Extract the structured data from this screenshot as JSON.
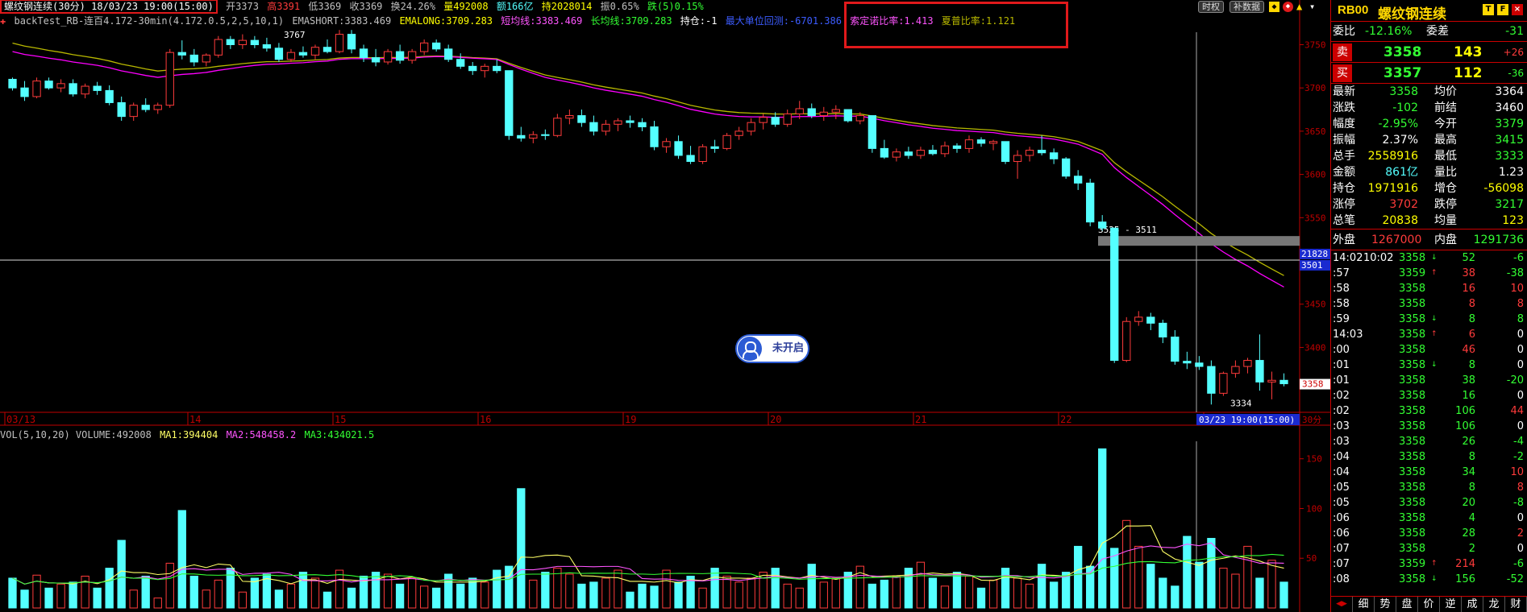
{
  "header": {
    "title": "螺纹钢连续(30分) 18/03/23 19:00(15:00)",
    "open": "开3373",
    "high": "高3391",
    "low": "低3369",
    "close": "收3369",
    "turnover": "换24.26%",
    "volume": "量492008",
    "amount": "额166亿",
    "oi": "持2028014",
    "amp": "振0.65%",
    "chg": "跌(5)0.15%",
    "btn_time": "时权",
    "btn_supp": "补数据"
  },
  "indicator": {
    "name": "backTest_RB-连百4.172-30min(4.172.0.5,2,5,10,1)",
    "emashort": "EMASHORT:3383.469",
    "emalong": "EMALONG:3709.283",
    "short_ma": "短均线:3383.469",
    "long_ma": "长均线:3709.283",
    "position": "持仓:-1",
    "max_dd": "最大单位回测:-6701.386",
    "calmar": "索定诺比率:1.413",
    "sharpe": "夏普比率:1.121"
  },
  "vol_header": {
    "name": "VOL(5,10,20) VOLUME:492008",
    "ma1": "MA1:394404",
    "ma2": "MA2:548458.2",
    "ma3": "MA3:434021.5"
  },
  "overlay": {
    "label_3767": "3767",
    "label_range": "3525 - 3511",
    "label_3334": "3334",
    "price_tag_top": "21828",
    "price_tag_bottom": "3501",
    "price_tag_last": "3358",
    "x_date": "03/23 19:00(15:00)",
    "period": "30分",
    "badge": "未开启"
  },
  "x_labels": [
    "03/13",
    "14",
    "15",
    "16",
    "19",
    "20",
    "21",
    "22",
    "23"
  ],
  "y_labels": [
    "3750",
    "3700",
    "3650",
    "3600",
    "3550",
    "3450",
    "3400"
  ],
  "vol_y_labels": [
    "150",
    "100",
    "50"
  ],
  "colors": {
    "up": "#ff3b3b",
    "down": "#54ffff",
    "ema_short": "#ff00ff",
    "ema_long": "#b8b800",
    "ma1": "#ffff66",
    "ma2": "#ff55ff",
    "ma3": "#33ff33",
    "axis": "#c00000"
  },
  "chart_data": {
    "type": "candlestick",
    "title": "螺纹钢连续(30分)",
    "ylim": [
      3325,
      3770
    ],
    "vol_ylim": [
      0,
      170
    ],
    "ohlc": [
      [
        3710,
        3712,
        3697,
        3700
      ],
      [
        3700,
        3708,
        3685,
        3690
      ],
      [
        3690,
        3712,
        3688,
        3708
      ],
      [
        3708,
        3712,
        3698,
        3700
      ],
      [
        3700,
        3710,
        3695,
        3705
      ],
      [
        3705,
        3710,
        3690,
        3693
      ],
      [
        3693,
        3705,
        3688,
        3702
      ],
      [
        3702,
        3707,
        3692,
        3697
      ],
      [
        3697,
        3703,
        3680,
        3683
      ],
      [
        3683,
        3690,
        3662,
        3667
      ],
      [
        3667,
        3683,
        3662,
        3680
      ],
      [
        3680,
        3688,
        3672,
        3675
      ],
      [
        3675,
        3683,
        3670,
        3680
      ],
      [
        3680,
        3745,
        3677,
        3741
      ],
      [
        3741,
        3755,
        3733,
        3738
      ],
      [
        3738,
        3745,
        3725,
        3730
      ],
      [
        3730,
        3740,
        3725,
        3738
      ],
      [
        3738,
        3760,
        3735,
        3756
      ],
      [
        3756,
        3760,
        3745,
        3750
      ],
      [
        3750,
        3762,
        3745,
        3755
      ],
      [
        3755,
        3760,
        3746,
        3750
      ],
      [
        3750,
        3758,
        3742,
        3746
      ],
      [
        3746,
        3752,
        3730,
        3733
      ],
      [
        3733,
        3745,
        3730,
        3741
      ],
      [
        3741,
        3748,
        3735,
        3738
      ],
      [
        3738,
        3750,
        3733,
        3747
      ],
      [
        3747,
        3756,
        3740,
        3742
      ],
      [
        3742,
        3767,
        3740,
        3762
      ],
      [
        3762,
        3767,
        3740,
        3745
      ],
      [
        3745,
        3750,
        3730,
        3735
      ],
      [
        3735,
        3745,
        3725,
        3730
      ],
      [
        3730,
        3745,
        3727,
        3742
      ],
      [
        3742,
        3750,
        3728,
        3732
      ],
      [
        3732,
        3745,
        3728,
        3742
      ],
      [
        3742,
        3756,
        3738,
        3752
      ],
      [
        3752,
        3756,
        3742,
        3745
      ],
      [
        3745,
        3750,
        3730,
        3733
      ],
      [
        3733,
        3740,
        3722,
        3725
      ],
      [
        3725,
        3730,
        3715,
        3720
      ],
      [
        3720,
        3728,
        3712,
        3725
      ],
      [
        3725,
        3733,
        3717,
        3720
      ],
      [
        3720,
        3708,
        3640,
        3645
      ],
      [
        3645,
        3655,
        3638,
        3642
      ],
      [
        3642,
        3650,
        3636,
        3646
      ],
      [
        3646,
        3652,
        3640,
        3645
      ],
      [
        3645,
        3670,
        3643,
        3665
      ],
      [
        3665,
        3675,
        3658,
        3668
      ],
      [
        3668,
        3675,
        3655,
        3660
      ],
      [
        3660,
        3668,
        3645,
        3650
      ],
      [
        3650,
        3663,
        3645,
        3658
      ],
      [
        3658,
        3665,
        3650,
        3662
      ],
      [
        3662,
        3668,
        3654,
        3660
      ],
      [
        3660,
        3665,
        3650,
        3655
      ],
      [
        3655,
        3662,
        3628,
        3632
      ],
      [
        3632,
        3642,
        3625,
        3638
      ],
      [
        3638,
        3645,
        3618,
        3622
      ],
      [
        3622,
        3633,
        3612,
        3615
      ],
      [
        3615,
        3635,
        3612,
        3632
      ],
      [
        3632,
        3640,
        3625,
        3630
      ],
      [
        3630,
        3648,
        3628,
        3645
      ],
      [
        3645,
        3655,
        3640,
        3650
      ],
      [
        3650,
        3665,
        3645,
        3660
      ],
      [
        3660,
        3670,
        3652,
        3666
      ],
      [
        3666,
        3672,
        3655,
        3658
      ],
      [
        3658,
        3675,
        3655,
        3670
      ],
      [
        3670,
        3685,
        3664,
        3676
      ],
      [
        3676,
        3682,
        3665,
        3668
      ],
      [
        3668,
        3678,
        3662,
        3672
      ],
      [
        3672,
        3680,
        3664,
        3675
      ],
      [
        3675,
        3670,
        3660,
        3662
      ],
      [
        3662,
        3672,
        3658,
        3668
      ],
      [
        3668,
        3652,
        3625,
        3630
      ],
      [
        3630,
        3640,
        3618,
        3620
      ],
      [
        3620,
        3630,
        3615,
        3626
      ],
      [
        3626,
        3632,
        3618,
        3622
      ],
      [
        3622,
        3632,
        3618,
        3628
      ],
      [
        3628,
        3634,
        3622,
        3624
      ],
      [
        3624,
        3638,
        3620,
        3633
      ],
      [
        3633,
        3636,
        3625,
        3630
      ],
      [
        3630,
        3645,
        3625,
        3640
      ],
      [
        3640,
        3643,
        3632,
        3636
      ],
      [
        3636,
        3640,
        3628,
        3638
      ],
      [
        3638,
        3625,
        3612,
        3615
      ],
      [
        3615,
        3628,
        3595,
        3622
      ],
      [
        3622,
        3632,
        3615,
        3628
      ],
      [
        3628,
        3645,
        3622,
        3625
      ],
      [
        3625,
        3630,
        3612,
        3618
      ],
      [
        3618,
        3620,
        3595,
        3598
      ],
      [
        3598,
        3605,
        3582,
        3590
      ],
      [
        3590,
        3595,
        3540,
        3545
      ],
      [
        3545,
        3553,
        3535,
        3538
      ],
      [
        3538,
        3511,
        3382,
        3385
      ],
      [
        3385,
        3435,
        3383,
        3430
      ],
      [
        3430,
        3442,
        3425,
        3435
      ],
      [
        3435,
        3440,
        3420,
        3428
      ],
      [
        3428,
        3432,
        3405,
        3412
      ],
      [
        3412,
        3420,
        3380,
        3384
      ],
      [
        3384,
        3395,
        3375,
        3382
      ],
      [
        3382,
        3390,
        3374,
        3378
      ],
      [
        3378,
        3385,
        3334,
        3347
      ],
      [
        3347,
        3372,
        3344,
        3370
      ],
      [
        3370,
        3385,
        3365,
        3378
      ],
      [
        3378,
        3388,
        3370,
        3385
      ],
      [
        3385,
        3415,
        3350,
        3360
      ],
      [
        3360,
        3372,
        3340,
        3362
      ],
      [
        3362,
        3370,
        3355,
        3358
      ]
    ],
    "volume": [
      30,
      18,
      33,
      20,
      24,
      26,
      32,
      20,
      40,
      68,
      18,
      32,
      10,
      45,
      98,
      32,
      18,
      28,
      40,
      16,
      30,
      34,
      18,
      24,
      36,
      30,
      16,
      38,
      20,
      32,
      36,
      34,
      24,
      30,
      22,
      20,
      34,
      24,
      30,
      26,
      38,
      42,
      120,
      28,
      36,
      40,
      34,
      24,
      26,
      30,
      38,
      16,
      24,
      22,
      38,
      26,
      32,
      20,
      40,
      32,
      26,
      30,
      36,
      40,
      24,
      20,
      44,
      26,
      30,
      36,
      42,
      24,
      28,
      32,
      40,
      46,
      30,
      22,
      36,
      32,
      20,
      28,
      40,
      30,
      24,
      44,
      26,
      36,
      62,
      42,
      160,
      60,
      88,
      62,
      44,
      30,
      22,
      72,
      46,
      70,
      40,
      34,
      62,
      30,
      48,
      26
    ],
    "x_ticks": [
      "03/13",
      "14",
      "15",
      "16",
      "19",
      "20",
      "21",
      "22",
      "23"
    ]
  },
  "quote": {
    "code": "RB00",
    "name": "螺纹钢连续",
    "weibi_label": "委比",
    "weibi": "-12.16%",
    "weicha_label": "委差",
    "weicha": "-31",
    "sell_label": "卖",
    "sell_price": "3358",
    "sell_vol": "143",
    "sell_diff": "+26",
    "buy_label": "买",
    "buy_price": "3357",
    "buy_vol": "112",
    "buy_diff": "-36",
    "rows": [
      {
        "l1": "最新",
        "v1": "3358",
        "l2": "均价",
        "v2": "3364",
        "c1": "#33ff33",
        "c2": "#ffffff"
      },
      {
        "l1": "涨跌",
        "v1": "-102",
        "l2": "前结",
        "v2": "3460",
        "c1": "#33ff33",
        "c2": "#ffffff"
      },
      {
        "l1": "幅度",
        "v1": "-2.95%",
        "l2": "今开",
        "v2": "3379",
        "c1": "#33ff33",
        "c2": "#33ff33"
      },
      {
        "l1": "振幅",
        "v1": "2.37%",
        "l2": "最高",
        "v2": "3415",
        "c1": "#ffffff",
        "c2": "#33ff33"
      },
      {
        "l1": "总手",
        "v1": "2558916",
        "l2": "最低",
        "v2": "3333",
        "c1": "#ffff00",
        "c2": "#33ff33"
      },
      {
        "l1": "金额",
        "v1": "861亿",
        "l2": "量比",
        "v2": "1.23",
        "c1": "#54ffff",
        "c2": "#ffffff"
      },
      {
        "l1": "持仓",
        "v1": "1971916",
        "l2": "增仓",
        "v2": "-56098",
        "c1": "#ffff00",
        "c2": "#ffff00"
      },
      {
        "l1": "涨停",
        "v1": "3702",
        "l2": "跌停",
        "v2": "3217",
        "c1": "#ff3b3b",
        "c2": "#33ff33"
      },
      {
        "l1": "总笔",
        "v1": "20838",
        "l2": "均量",
        "v2": "123",
        "c1": "#ffff00",
        "c2": "#ffff00"
      }
    ],
    "outer_label": "外盘",
    "outer": "1267000",
    "inner_label": "内盘",
    "inner": "1291736",
    "ticks": [
      {
        "t": "14:02",
        "t2": "10:02",
        "p": "3358",
        "a": "↓",
        "v": "52",
        "d": "-6",
        "vc": "#33ff33",
        "dc": "#33ff33"
      },
      {
        "t": ":57",
        "t2": "",
        "p": "3359",
        "a": "↑",
        "v": "38",
        "d": "-38",
        "vc": "#ff3b3b",
        "dc": "#33ff33"
      },
      {
        "t": ":58",
        "t2": "",
        "p": "3358",
        "a": "",
        "v": "16",
        "d": "10",
        "vc": "#ff3b3b",
        "dc": "#ff3b3b"
      },
      {
        "t": ":58",
        "t2": "",
        "p": "3358",
        "a": "",
        "v": "8",
        "d": "8",
        "vc": "#ff3b3b",
        "dc": "#ff3b3b"
      },
      {
        "t": ":59",
        "t2": "",
        "p": "3358",
        "a": "↓",
        "v": "8",
        "d": "8",
        "vc": "#33ff33",
        "dc": "#33ff33"
      },
      {
        "t": "14:03",
        "t2": "",
        "p": "3358",
        "a": "↑",
        "v": "6",
        "d": "0",
        "vc": "#ff3b3b",
        "dc": "#ffffff"
      },
      {
        "t": ":00",
        "t2": "",
        "p": "3358",
        "a": "",
        "v": "46",
        "d": "0",
        "vc": "#ff3b3b",
        "dc": "#ffffff"
      },
      {
        "t": ":01",
        "t2": "",
        "p": "3358",
        "a": "↓",
        "v": "8",
        "d": "0",
        "vc": "#33ff33",
        "dc": "#ffffff"
      },
      {
        "t": ":01",
        "t2": "",
        "p": "3358",
        "a": "",
        "v": "38",
        "d": "-20",
        "vc": "#33ff33",
        "dc": "#33ff33"
      },
      {
        "t": ":02",
        "t2": "",
        "p": "3358",
        "a": "",
        "v": "16",
        "d": "0",
        "vc": "#33ff33",
        "dc": "#ffffff"
      },
      {
        "t": ":02",
        "t2": "",
        "p": "3358",
        "a": "",
        "v": "106",
        "d": "44",
        "vc": "#33ff33",
        "dc": "#ff3b3b"
      },
      {
        "t": ":03",
        "t2": "",
        "p": "3358",
        "a": "",
        "v": "106",
        "d": "0",
        "vc": "#33ff33",
        "dc": "#ffffff"
      },
      {
        "t": ":03",
        "t2": "",
        "p": "3358",
        "a": "",
        "v": "26",
        "d": "-4",
        "vc": "#33ff33",
        "dc": "#33ff33"
      },
      {
        "t": ":04",
        "t2": "",
        "p": "3358",
        "a": "",
        "v": "8",
        "d": "-2",
        "vc": "#33ff33",
        "dc": "#33ff33"
      },
      {
        "t": ":04",
        "t2": "",
        "p": "3358",
        "a": "",
        "v": "34",
        "d": "10",
        "vc": "#33ff33",
        "dc": "#ff3b3b"
      },
      {
        "t": ":05",
        "t2": "",
        "p": "3358",
        "a": "",
        "v": "8",
        "d": "8",
        "vc": "#33ff33",
        "dc": "#ff3b3b"
      },
      {
        "t": ":05",
        "t2": "",
        "p": "3358",
        "a": "",
        "v": "20",
        "d": "-8",
        "vc": "#33ff33",
        "dc": "#33ff33"
      },
      {
        "t": ":06",
        "t2": "",
        "p": "3358",
        "a": "",
        "v": "4",
        "d": "0",
        "vc": "#33ff33",
        "dc": "#ffffff"
      },
      {
        "t": ":06",
        "t2": "",
        "p": "3358",
        "a": "",
        "v": "28",
        "d": "2",
        "vc": "#33ff33",
        "dc": "#ff3b3b"
      },
      {
        "t": ":07",
        "t2": "",
        "p": "3358",
        "a": "",
        "v": "2",
        "d": "0",
        "vc": "#33ff33",
        "dc": "#ffffff"
      },
      {
        "t": ":07",
        "t2": "",
        "p": "3359",
        "a": "↑",
        "v": "214",
        "d": "-6",
        "vc": "#ff3b3b",
        "dc": "#33ff33"
      },
      {
        "t": ":08",
        "t2": "",
        "p": "3358",
        "a": "↓",
        "v": "156",
        "d": "-52",
        "vc": "#33ff33",
        "dc": "#33ff33"
      }
    ],
    "tabs": [
      "细",
      "势",
      "盘",
      "价",
      "逆",
      "成",
      "龙",
      "财"
    ]
  }
}
